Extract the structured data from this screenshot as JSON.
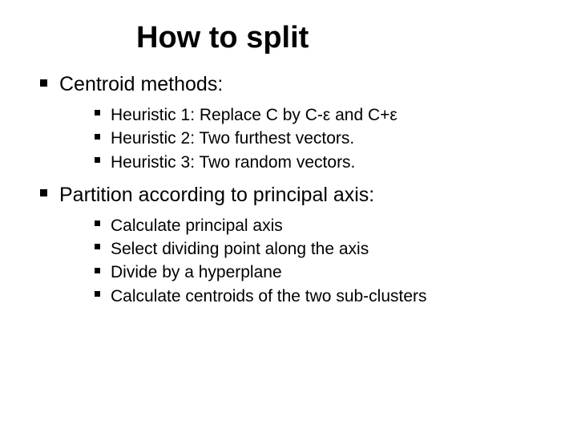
{
  "title": "How to split",
  "sections": [
    {
      "heading": "Centroid methods:",
      "items": [
        "Heuristic 1: Replace C by C-ε and C+ε",
        "Heuristic 2: Two furthest vectors.",
        "Heuristic 3: Two random vectors."
      ]
    },
    {
      "heading": "Partition according to principal axis:",
      "items": [
        "Calculate principal axis",
        "Select dividing point along the axis",
        "Divide by a hyperplane",
        "Calculate centroids of the two sub-clusters"
      ]
    }
  ]
}
